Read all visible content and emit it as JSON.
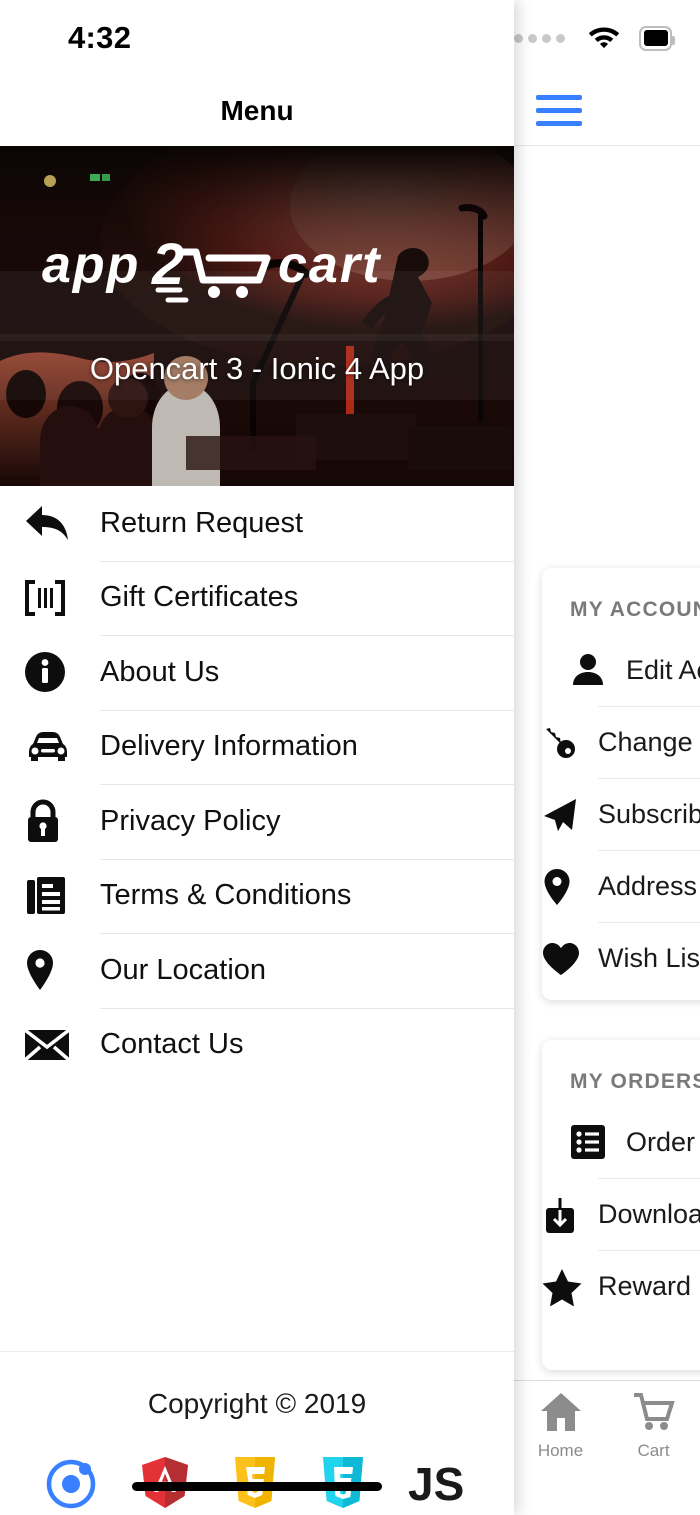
{
  "status_bar": {
    "time": "4:32",
    "signal_icon": "signal-dots-icon",
    "wifi_icon": "wifi-icon",
    "battery_icon": "battery-full-icon"
  },
  "drawer": {
    "toolbar": {
      "title": "Menu",
      "menu_icon": "hamburger-menu-icon"
    },
    "banner": {
      "logo_text": "app2cart",
      "caption": "Opencart 3 - Ionic 4 App"
    },
    "items": [
      {
        "label": "Return Request",
        "icon": "reply-arrow-icon"
      },
      {
        "label": "Gift Certificates",
        "icon": "barcode-icon"
      },
      {
        "label": "About Us",
        "icon": "info-circle-icon"
      },
      {
        "label": "Delivery Information",
        "icon": "car-icon"
      },
      {
        "label": "Privacy Policy",
        "icon": "lock-icon"
      },
      {
        "label": "Terms & Conditions",
        "icon": "document-list-icon"
      },
      {
        "label": "Our Location",
        "icon": "map-pin-icon"
      },
      {
        "label": "Contact Us",
        "icon": "envelope-icon"
      }
    ],
    "footer": {
      "copyright": "Copyright © 2019",
      "logos": [
        {
          "name": "ionic-logo-icon",
          "label": "Ionic",
          "color": "#3880ff"
        },
        {
          "name": "angular-logo-icon",
          "label": "A",
          "color": "#e23237"
        },
        {
          "name": "html5-logo-icon",
          "label": "5",
          "color": "#fcc21b"
        },
        {
          "name": "css3-logo-icon",
          "label": "3",
          "color": "#22d3ee"
        },
        {
          "name": "javascript-logo-icon",
          "label": "JS",
          "color": "#1a1a1a"
        }
      ]
    }
  },
  "background_page": {
    "cards": [
      {
        "title": "MY ACCOUNT",
        "rows": [
          {
            "label": "Edit Account",
            "icon": "person-icon"
          },
          {
            "label": "Change Password",
            "icon": "key-icon"
          },
          {
            "label": "Subscribe Newsletter",
            "icon": "paper-plane-icon"
          },
          {
            "label": "Address Book",
            "icon": "map-pin-icon"
          },
          {
            "label": "Wish List",
            "icon": "heart-icon"
          }
        ]
      },
      {
        "title": "MY ORDERS",
        "rows": [
          {
            "label": "Order History",
            "icon": "list-icon"
          },
          {
            "label": "Downloads",
            "icon": "download-icon"
          },
          {
            "label": "Reward Points",
            "icon": "star-icon"
          }
        ]
      }
    ],
    "tabs": [
      {
        "label": "Home",
        "icon": "home-icon"
      },
      {
        "label": "Cart",
        "icon": "cart-icon"
      }
    ]
  },
  "colors": {
    "accent": "#3880ff",
    "text": "#101010",
    "muted": "#7a7a7a",
    "divider": "#e6e6e6"
  }
}
